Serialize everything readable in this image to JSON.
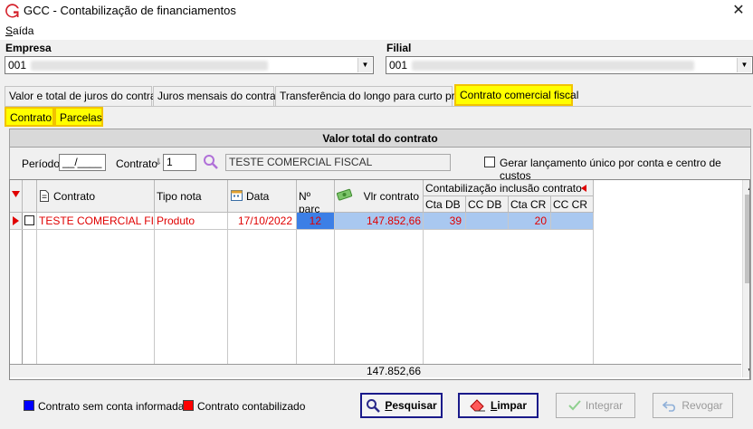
{
  "window": {
    "title": "GCC - Contabilização de financiamentos",
    "close_glyph": "✕"
  },
  "menu": {
    "items": [
      {
        "accel": "S",
        "rest": "aída"
      }
    ]
  },
  "empresa": {
    "label": "Empresa",
    "value": "001"
  },
  "filial": {
    "label": "Filial",
    "value": "001"
  },
  "tabs": [
    {
      "label": "Valor e total de juros do contrato"
    },
    {
      "label": "Juros mensais do contrato"
    },
    {
      "label": "Transferência do longo para curto prazo"
    },
    {
      "label": "Contrato comercial fiscal",
      "active": true
    }
  ],
  "subtabs": [
    {
      "label": "Contrato",
      "active": true
    },
    {
      "label": "Parcelas"
    }
  ],
  "panel": {
    "title": "Valor total do contrato",
    "periodo_label": "Período",
    "periodo_value": "__/____",
    "contrato_label": "Contrato",
    "contrato_value": "1",
    "contrato_desc": "TESTE COMERCIAL FISCAL",
    "gerar_label": "Gerar lançamento único por conta e centro de custos"
  },
  "grid": {
    "columns": {
      "contrato": "Contrato",
      "tipo_nota": "Tipo nota",
      "data": "Data",
      "nparc": "Nº parc",
      "vlr": "Vlr contrato",
      "group": "Contabilização inclusão contrato",
      "cta_db": "Cta DB",
      "cc_db": "CC DB",
      "cta_cr": "Cta CR",
      "cc_cr": "CC CR"
    },
    "rows": [
      {
        "contrato": "TESTE COMERCIAL FI...",
        "tipo_nota": "Produto",
        "data": "17/10/2022",
        "nparc": "12",
        "vlr": "147.852,66",
        "cta_db": "39",
        "cc_db": "",
        "cta_cr": "20",
        "cc_cr": ""
      }
    ],
    "total": "147.852,66"
  },
  "legend": {
    "items": [
      {
        "label": "Contrato sem conta informada",
        "color": "#0000ff"
      },
      {
        "label": "Contrato contabilizado",
        "color": "#ff0000"
      }
    ]
  },
  "buttons": {
    "pesquisar": {
      "accel": "P",
      "rest": "esquisar"
    },
    "limpar": {
      "accel": "L",
      "rest": "impar"
    },
    "integrar": "Integrar",
    "revogar": "Revogar"
  },
  "colors": {
    "tab_active": "#ffff00",
    "row_text": "#e00000",
    "row_select": "#a9c8f0"
  }
}
